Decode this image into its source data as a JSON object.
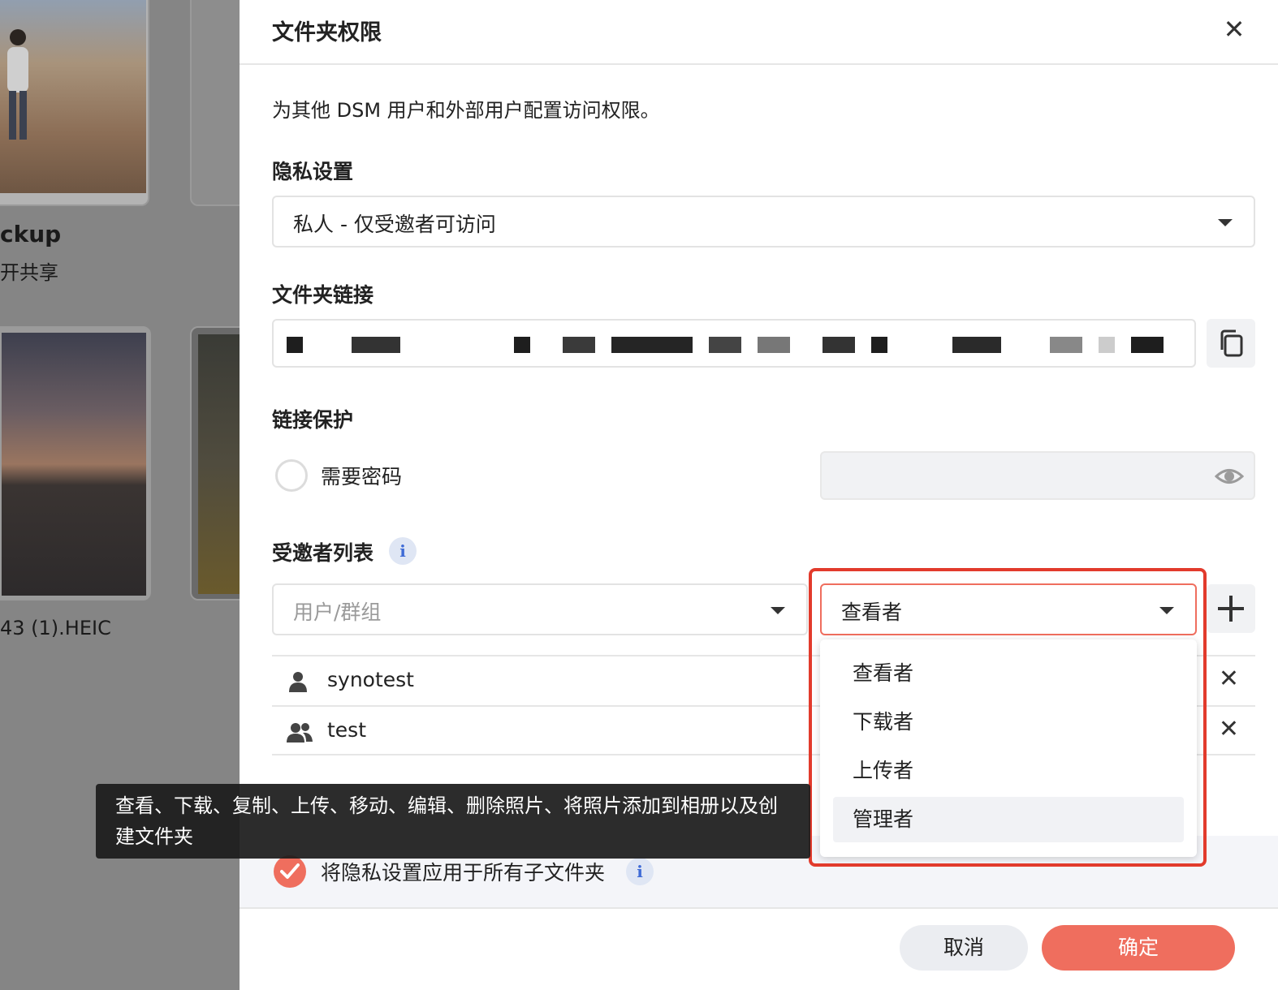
{
  "background": {
    "folder_title_partial": "ckup",
    "folder_subtitle_partial": "开共享",
    "file_name_partial": "43 (1).HEIC"
  },
  "dialog": {
    "title": "文件夹权限",
    "description": "为其他 DSM 用户和外部用户配置访问权限。",
    "privacy": {
      "label": "隐私设置",
      "selected": "私人 - 仅受邀者可访问"
    },
    "folder_link": {
      "label": "文件夹链接"
    },
    "link_protection": {
      "label": "链接保护",
      "require_password_label": "需要密码",
      "require_password_checked": false
    },
    "invitee_list": {
      "label": "受邀者列表",
      "user_group_placeholder": "用户/群组",
      "role_selected": "查看者",
      "role_options": [
        "查看者",
        "下载者",
        "上传者",
        "管理者"
      ],
      "role_hovered": "管理者",
      "rows": [
        {
          "name": "synotest",
          "type": "user"
        },
        {
          "name": "test",
          "type": "group"
        }
      ]
    },
    "tooltip_text": "查看、下载、复制、上传、移动、编辑、删除照片、将照片添加到相册以及创建文件夹",
    "apply_subfolders": {
      "label": "将隐私设置应用于所有子文件夹",
      "checked": true
    },
    "buttons": {
      "cancel": "取消",
      "ok": "确定"
    }
  },
  "colors": {
    "accent": "#ef6e5e",
    "highlight_border": "#e23b2c",
    "info_icon": "#3f6bd6"
  }
}
